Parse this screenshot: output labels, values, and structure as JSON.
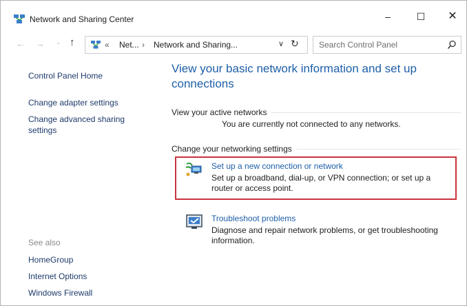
{
  "window": {
    "title": "Network and Sharing Center",
    "controls": {
      "minimize": "–",
      "maximize": "☐",
      "close": "✕"
    }
  },
  "navigation": {
    "back": "←",
    "forward": "→",
    "recent": "⌄",
    "up": "↑",
    "address": {
      "separator1": "«",
      "crumb1": "Net...",
      "separator2": "›",
      "crumb2": "Network and Sharing...",
      "dropdown": "∨",
      "refresh": "↻"
    },
    "search": {
      "placeholder": "Search Control Panel"
    }
  },
  "left_pane": {
    "home": "Control Panel Home",
    "links": [
      "Change adapter settings",
      "Change advanced sharing settings"
    ],
    "see_also_heading": "See also",
    "see_also": [
      "HomeGroup",
      "Internet Options",
      "Windows Firewall"
    ]
  },
  "main": {
    "title": "View your basic network information and set up connections",
    "active_networks": {
      "heading": "View your active networks",
      "status": "You are currently not connected to any networks."
    },
    "settings": {
      "heading": "Change your networking settings",
      "tasks": [
        {
          "link": "Set up a new connection or network",
          "description": "Set up a broadband, dial-up, or VPN connection; or set up a router or access point.",
          "icon": "network-setup-icon",
          "highlighted": true
        },
        {
          "link": "Troubleshoot problems",
          "description": "Diagnose and repair network problems, or get troubleshooting information.",
          "icon": "troubleshoot-icon",
          "highlighted": false
        }
      ]
    }
  },
  "colors": {
    "link": "#1e5fa8",
    "left_link": "#1e3a6b",
    "highlight": "#c8333c",
    "muted": "#8a8a8a"
  }
}
